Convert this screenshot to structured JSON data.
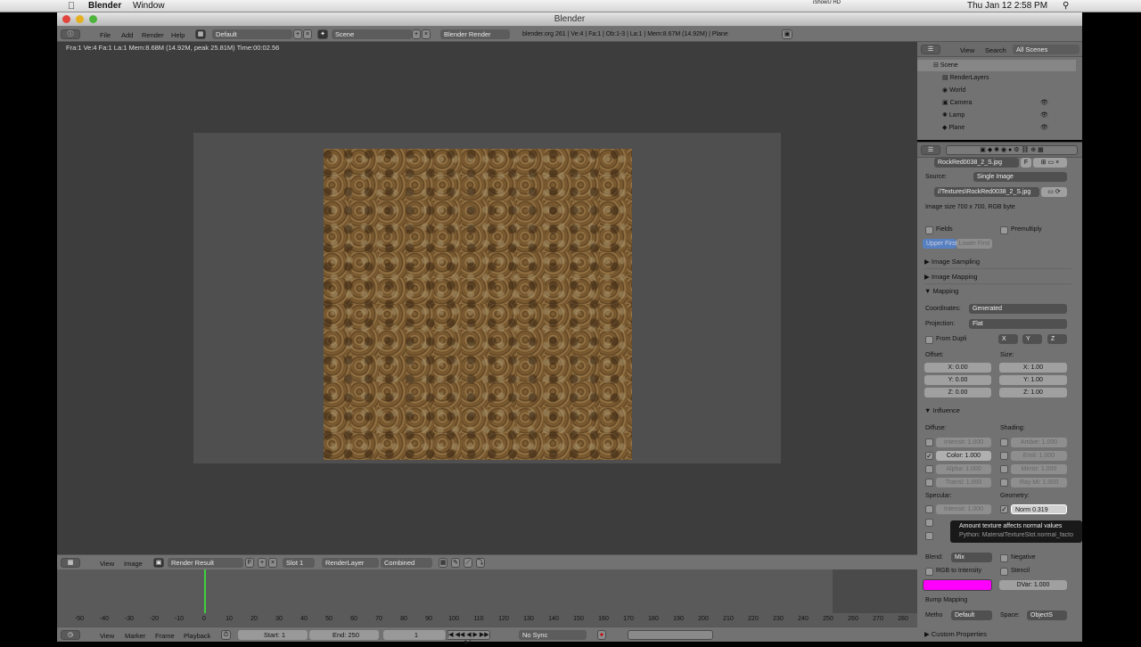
{
  "mac_menubar": {
    "app": "Blender",
    "window": "Window",
    "clock": "Thu Jan 12  2:58 PM",
    "ishowu": "iShowU HD"
  },
  "window_title": "Blender",
  "header": {
    "menus": [
      "File",
      "Add",
      "Render",
      "Help"
    ],
    "layout": "Default",
    "scene": "Scene",
    "engine": "Blender Render",
    "stats": "blender.org 261 | Ve:4 | Fa:1 | Ob:1-3 | La:1 | Mem:8.67M (14.92M) | Plane"
  },
  "render_info": "Fra:1  Ve:4 Fa:1 La:1 Mem:8.68M (14.92M, peak 25.81M) Time:00:02.56",
  "image_editor": {
    "menus": [
      "View",
      "Image"
    ],
    "image": "Render Result",
    "slot": "Slot 1",
    "layer": "RenderLayer",
    "pass": "Combined"
  },
  "timeline": {
    "ticks": [
      "-50",
      "-40",
      "-30",
      "-20",
      "-10",
      "0",
      "10",
      "20",
      "30",
      "40",
      "50",
      "60",
      "70",
      "80",
      "90",
      "100",
      "110",
      "120",
      "130",
      "140",
      "150",
      "160",
      "170",
      "180",
      "190",
      "200",
      "210",
      "220",
      "230",
      "240",
      "250",
      "260",
      "270",
      "280"
    ],
    "menus": [
      "View",
      "Marker",
      "Frame",
      "Playback"
    ],
    "start": "Start: 1",
    "end": "End: 250",
    "current": "1",
    "sync": "No Sync"
  },
  "outliner": {
    "menus": [
      "View",
      "Search"
    ],
    "filter": "All Scenes",
    "items": [
      "Scene",
      "RenderLayers",
      "World",
      "Camera",
      "Lamp",
      "Plane"
    ]
  },
  "properties": {
    "image_name": "RockRed0038_2_S.jpg",
    "image_flag": "F",
    "source_label": "Source:",
    "source": "Single Image",
    "path": "//Textures\\RockRed0038_2_S.jpg",
    "image_info": "Image size 700 x 700, RGB byte",
    "fields": "Fields",
    "premultiply": "Premultiply",
    "upper_first": "Upper First",
    "lower_first": "Lower First",
    "sec_sampling": "Image Sampling",
    "sec_img_mapping": "Image Mapping",
    "sec_mapping": "Mapping",
    "coordinates_label": "Coordinates:",
    "coordinates": "Generated",
    "projection_label": "Projection:",
    "projection": "Flat",
    "from_dupli": "From Dupli",
    "axes": [
      "X",
      "Y",
      "Z"
    ],
    "offset_label": "Offset:",
    "size_label": "Size:",
    "offset": [
      "X: 0.00",
      "Y: 0.00",
      "Z: 0.00"
    ],
    "size": [
      "X: 1.00",
      "Y: 1.00",
      "Z: 1.00"
    ],
    "sec_influence": "Influence",
    "diffuse_label": "Diffuse:",
    "shading_label": "Shading:",
    "diffuse": [
      "Intensit: 1.000",
      "Color: 1.000",
      "Alpha: 1.000",
      "Transl: 1.000"
    ],
    "shading": [
      "Ambie: 1.000",
      "Emit: 1.000",
      "Mirror: 1.000",
      "Ray Mi: 1.000"
    ],
    "specular_label": "Specular:",
    "geometry_label": "Geometry:",
    "specular": "Intensit: 1.000",
    "normal_label": "Norm",
    "normal_value": "0.319",
    "tooltip_title": "Amount texture affects normal values",
    "tooltip_python": "Python: MaterialTextureSlot.normal_factor",
    "blend_label": "Blend:",
    "blend": "Mix",
    "negative": "Negative",
    "rgb_to_intensity": "RGB to Intensity",
    "stencil": "Stencil",
    "dvar": "DVar: 1.000",
    "color_swatch": "#ff00ff",
    "bump_label": "Bump Mapping",
    "method_label": "Metho",
    "method": "Default",
    "space_label": "Space:",
    "space": "ObjectS",
    "custom_props": "Custom Properties"
  }
}
